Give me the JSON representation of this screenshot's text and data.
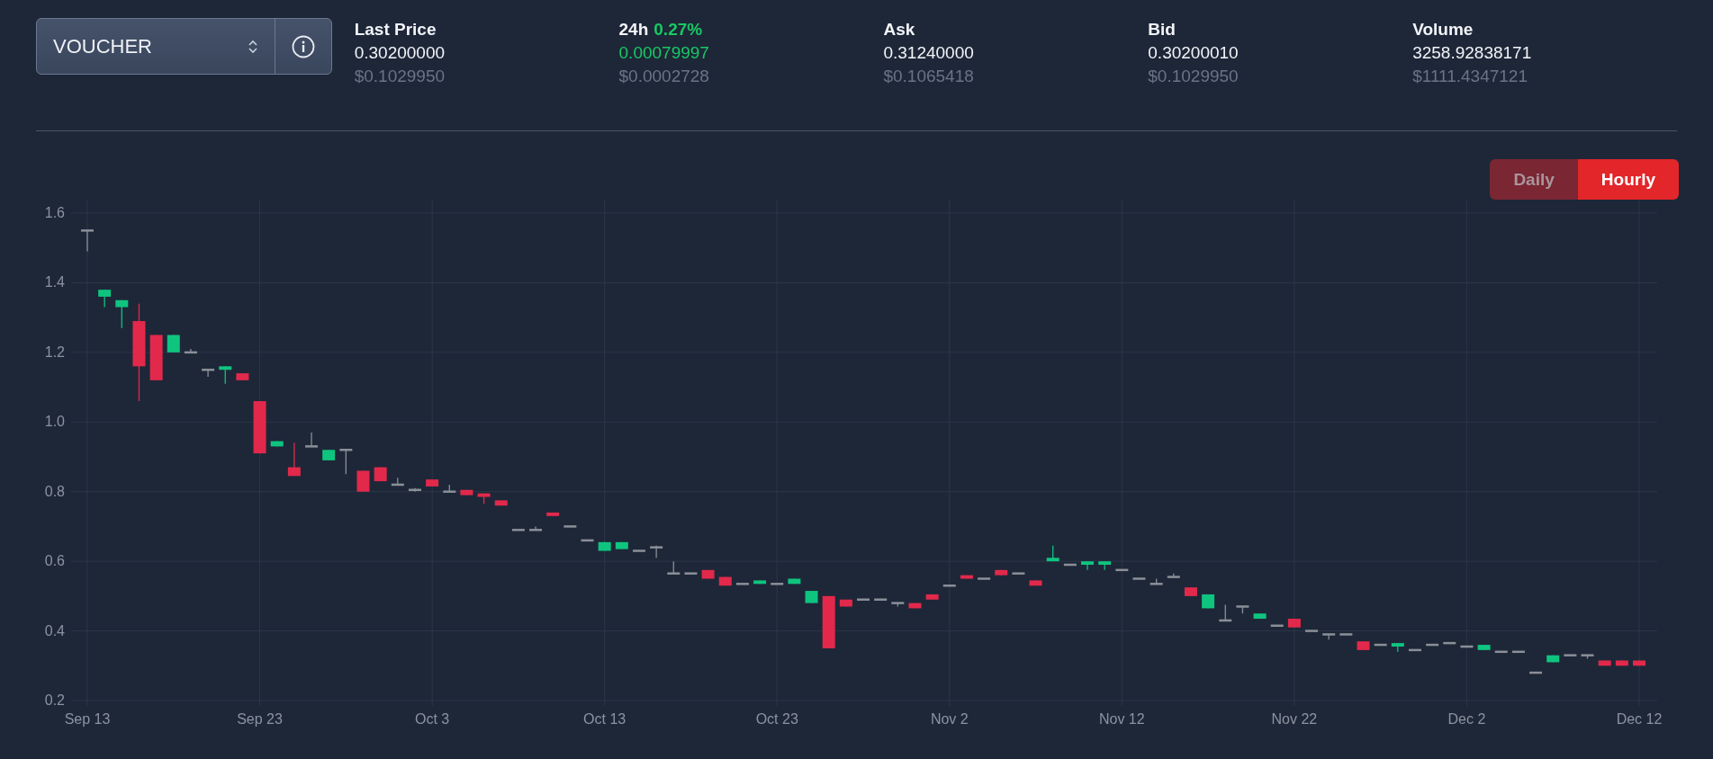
{
  "pair_select": {
    "value": "VOUCHER"
  },
  "stats": [
    {
      "kind": "plain",
      "label": "Last Price",
      "value": "0.30200000",
      "usd": "$0.1029950"
    },
    {
      "kind": "change",
      "label": "24h",
      "change": "0.27%",
      "value": "0.00079997",
      "usd": "$0.0002728"
    },
    {
      "kind": "plain",
      "label": "Ask",
      "value": "0.31240000",
      "usd": "$0.1065418"
    },
    {
      "kind": "plain",
      "label": "Bid",
      "value": "0.30200010",
      "usd": "$0.1029950"
    },
    {
      "kind": "plain",
      "label": "Volume",
      "value": "3258.92838171",
      "usd": "$1111.4347121"
    }
  ],
  "range_tabs": [
    {
      "label": "Daily",
      "selected": false
    },
    {
      "label": "Hourly",
      "selected": true
    }
  ],
  "chart": {
    "chart_data": {
      "type": "candlestick",
      "grid": true,
      "ylim": [
        0.2,
        1.6
      ],
      "yticks": [
        {
          "value": 0.2,
          "label": "0.2"
        },
        {
          "value": 0.4,
          "label": "0.4"
        },
        {
          "value": 0.6,
          "label": "0.6"
        },
        {
          "value": 0.8,
          "label": "0.8"
        },
        {
          "value": 1.0,
          "label": "1.0"
        },
        {
          "value": 1.2,
          "label": "1.2"
        },
        {
          "value": 1.4,
          "label": "1.4"
        },
        {
          "value": 1.6,
          "label": "1.6"
        }
      ],
      "categories": [
        "Sep 13",
        null,
        null,
        null,
        null,
        null,
        null,
        null,
        null,
        null,
        "Sep 23",
        null,
        null,
        null,
        null,
        null,
        null,
        null,
        null,
        null,
        "Oct 3",
        null,
        null,
        null,
        null,
        null,
        null,
        null,
        null,
        null,
        "Oct 13",
        null,
        null,
        null,
        null,
        null,
        null,
        null,
        null,
        null,
        "Oct 23",
        null,
        null,
        null,
        null,
        null,
        null,
        null,
        null,
        null,
        "Nov 2",
        null,
        null,
        null,
        null,
        null,
        null,
        null,
        null,
        null,
        "Nov 12",
        null,
        null,
        null,
        null,
        null,
        null,
        null,
        null,
        null,
        "Nov 22",
        null,
        null,
        null,
        null,
        null,
        null,
        null,
        null,
        null,
        "Dec 2",
        null,
        null,
        null,
        null,
        null,
        null,
        null,
        null,
        null,
        "Dec 12"
      ],
      "ohlc": [
        [
          1.55,
          1.55,
          1.49,
          1.55
        ],
        [
          1.36,
          1.38,
          1.33,
          1.38
        ],
        [
          1.33,
          1.35,
          1.27,
          1.35
        ],
        [
          1.29,
          1.34,
          1.06,
          1.16
        ],
        [
          1.25,
          1.25,
          1.12,
          1.12
        ],
        [
          1.2,
          1.25,
          1.2,
          1.25
        ],
        [
          1.2,
          1.21,
          1.2,
          1.2
        ],
        [
          1.15,
          1.15,
          1.13,
          1.15
        ],
        [
          1.15,
          1.16,
          1.11,
          1.16
        ],
        [
          1.14,
          1.14,
          1.12,
          1.12
        ],
        [
          1.06,
          1.06,
          0.91,
          0.91
        ],
        [
          0.93,
          0.945,
          0.93,
          0.945
        ],
        [
          0.87,
          0.94,
          0.845,
          0.845
        ],
        [
          0.93,
          0.97,
          0.93,
          0.93
        ],
        [
          0.89,
          0.92,
          0.89,
          0.92
        ],
        [
          0.92,
          0.92,
          0.85,
          0.92
        ],
        [
          0.86,
          0.86,
          0.8,
          0.8
        ],
        [
          0.87,
          0.87,
          0.83,
          0.83
        ],
        [
          0.82,
          0.84,
          0.82,
          0.82
        ],
        [
          0.805,
          0.81,
          0.8,
          0.805
        ],
        [
          0.835,
          0.835,
          0.815,
          0.815
        ],
        [
          0.8,
          0.82,
          0.8,
          0.8
        ],
        [
          0.805,
          0.805,
          0.79,
          0.79
        ],
        [
          0.795,
          0.795,
          0.765,
          0.785
        ],
        [
          0.775,
          0.775,
          0.76,
          0.76
        ],
        [
          0.69,
          0.69,
          0.69,
          0.69
        ],
        [
          0.69,
          0.7,
          0.69,
          0.69
        ],
        [
          0.74,
          0.74,
          0.73,
          0.73
        ],
        [
          0.7,
          0.7,
          0.7,
          0.7
        ],
        [
          0.66,
          0.66,
          0.66,
          0.66
        ],
        [
          0.63,
          0.655,
          0.63,
          0.655
        ],
        [
          0.635,
          0.655,
          0.635,
          0.655
        ],
        [
          0.63,
          0.63,
          0.63,
          0.63
        ],
        [
          0.64,
          0.645,
          0.61,
          0.64
        ],
        [
          0.565,
          0.6,
          0.565,
          0.565
        ],
        [
          0.565,
          0.565,
          0.565,
          0.565
        ],
        [
          0.575,
          0.575,
          0.55,
          0.55
        ],
        [
          0.555,
          0.555,
          0.53,
          0.53
        ],
        [
          0.535,
          0.535,
          0.535,
          0.535
        ],
        [
          0.535,
          0.545,
          0.535,
          0.545
        ],
        [
          0.535,
          0.535,
          0.535,
          0.535
        ],
        [
          0.535,
          0.55,
          0.535,
          0.55
        ],
        [
          0.48,
          0.515,
          0.48,
          0.515
        ],
        [
          0.5,
          0.5,
          0.35,
          0.35
        ],
        [
          0.49,
          0.49,
          0.47,
          0.47
        ],
        [
          0.49,
          0.49,
          0.49,
          0.49
        ],
        [
          0.49,
          0.49,
          0.49,
          0.49
        ],
        [
          0.48,
          0.48,
          0.47,
          0.48
        ],
        [
          0.48,
          0.48,
          0.465,
          0.465
        ],
        [
          0.505,
          0.505,
          0.49,
          0.49
        ],
        [
          0.53,
          0.53,
          0.53,
          0.53
        ],
        [
          0.56,
          0.56,
          0.55,
          0.55
        ],
        [
          0.55,
          0.55,
          0.55,
          0.55
        ],
        [
          0.575,
          0.575,
          0.56,
          0.56
        ],
        [
          0.565,
          0.565,
          0.565,
          0.565
        ],
        [
          0.545,
          0.545,
          0.53,
          0.53
        ],
        [
          0.6,
          0.645,
          0.6,
          0.61
        ],
        [
          0.59,
          0.59,
          0.59,
          0.59
        ],
        [
          0.59,
          0.6,
          0.575,
          0.6
        ],
        [
          0.59,
          0.6,
          0.575,
          0.6
        ],
        [
          0.575,
          0.575,
          0.575,
          0.575
        ],
        [
          0.55,
          0.55,
          0.55,
          0.55
        ],
        [
          0.535,
          0.55,
          0.535,
          0.535
        ],
        [
          0.555,
          0.565,
          0.555,
          0.555
        ],
        [
          0.525,
          0.525,
          0.5,
          0.5
        ],
        [
          0.465,
          0.505,
          0.465,
          0.505
        ],
        [
          0.43,
          0.475,
          0.43,
          0.43
        ],
        [
          0.47,
          0.47,
          0.45,
          0.47
        ],
        [
          0.435,
          0.45,
          0.435,
          0.45
        ],
        [
          0.415,
          0.415,
          0.415,
          0.415
        ],
        [
          0.435,
          0.435,
          0.41,
          0.41
        ],
        [
          0.4,
          0.4,
          0.4,
          0.4
        ],
        [
          0.39,
          0.39,
          0.375,
          0.39
        ],
        [
          0.39,
          0.39,
          0.39,
          0.39
        ],
        [
          0.37,
          0.37,
          0.345,
          0.345
        ],
        [
          0.36,
          0.36,
          0.36,
          0.36
        ],
        [
          0.355,
          0.365,
          0.34,
          0.365
        ],
        [
          0.345,
          0.345,
          0.345,
          0.345
        ],
        [
          0.36,
          0.36,
          0.36,
          0.36
        ],
        [
          0.365,
          0.365,
          0.365,
          0.365
        ],
        [
          0.355,
          0.355,
          0.355,
          0.355
        ],
        [
          0.345,
          0.36,
          0.345,
          0.36
        ],
        [
          0.34,
          0.34,
          0.34,
          0.34
        ],
        [
          0.34,
          0.34,
          0.34,
          0.34
        ],
        [
          0.28,
          0.28,
          0.28,
          0.28
        ],
        [
          0.31,
          0.33,
          0.31,
          0.33
        ],
        [
          0.33,
          0.33,
          0.33,
          0.33
        ],
        [
          0.33,
          0.33,
          0.32,
          0.33
        ],
        [
          0.315,
          0.315,
          0.3,
          0.3
        ],
        [
          0.315,
          0.315,
          0.3,
          0.3
        ],
        [
          0.315,
          0.315,
          0.3,
          0.3
        ]
      ]
    }
  }
}
